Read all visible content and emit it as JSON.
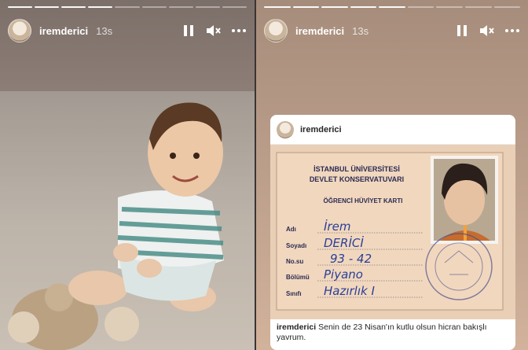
{
  "left_story": {
    "progress_segments": 9,
    "progress_done": 4,
    "username": "iremderici",
    "time": "13s"
  },
  "right_story": {
    "progress_segments": 9,
    "progress_done": 5,
    "username": "iremderici",
    "time": "13s",
    "post": {
      "username": "iremderici",
      "card": {
        "institution_line1": "İSTANBUL ÜNİVERSİTESİ",
        "institution_line2": "DEVLET KONSERVATUVARI",
        "card_title": "ÖĞRENCİ HÜVİYET KARTI",
        "fields": [
          {
            "label": "Adı",
            "value": "İrem"
          },
          {
            "label": "Soyadı",
            "value": "DERİCİ"
          },
          {
            "label": "No.su",
            "value": "93 - 42"
          },
          {
            "label": "Bölümü",
            "value": "Piyano"
          },
          {
            "label": "Sınıfı",
            "value": "Hazırlık I"
          }
        ]
      },
      "caption_user": "iremderici",
      "caption_text": "Senin de 23 Nisan'ın kutlu olsun hicran bakışlı yavrum."
    }
  },
  "icons": {
    "pause": "pause-icon",
    "mute": "speaker-muted-icon",
    "more": "more-dots-icon"
  }
}
